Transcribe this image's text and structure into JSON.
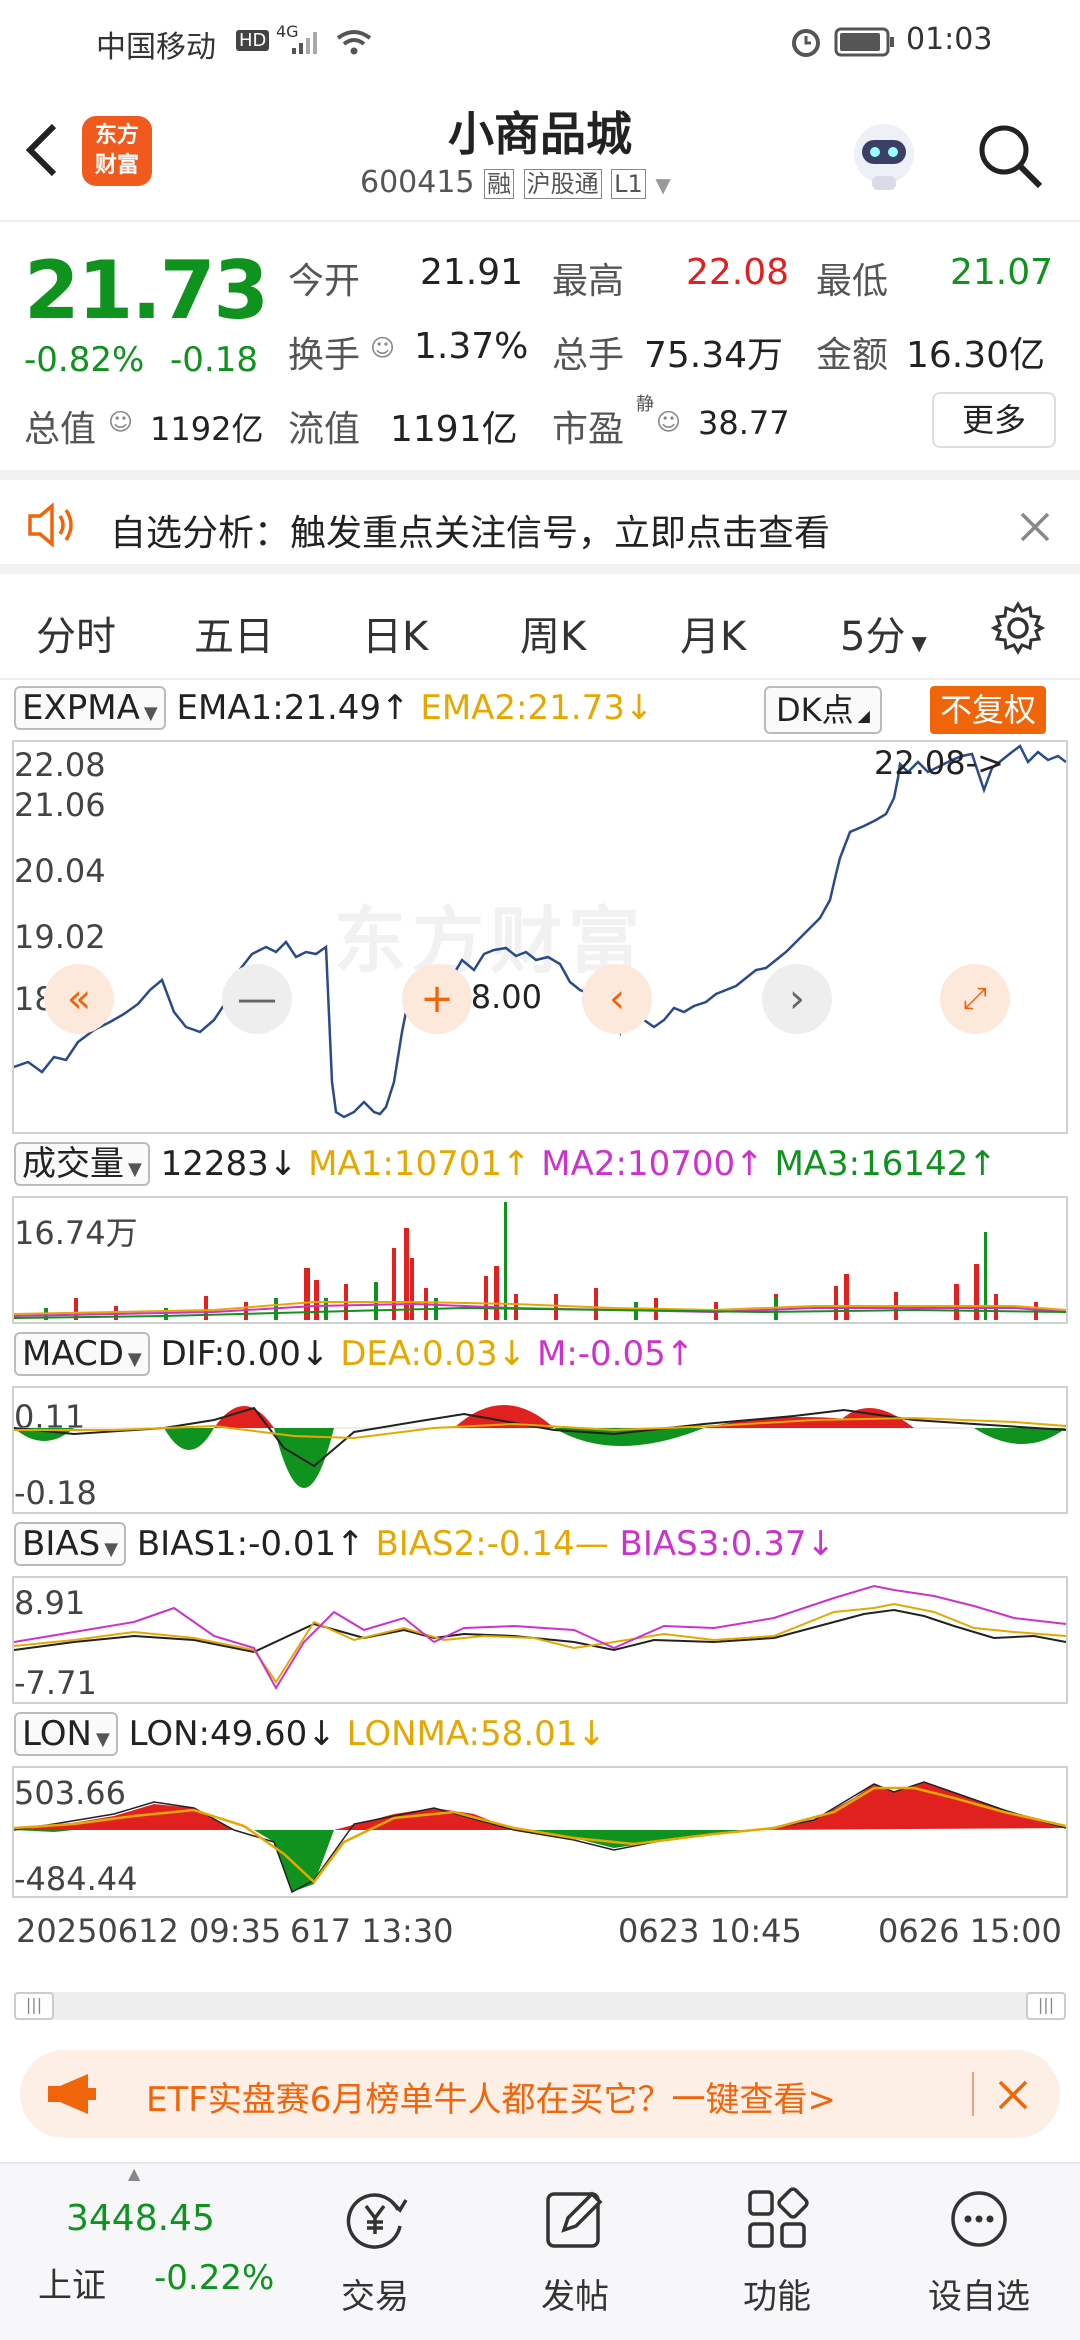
{
  "status_bar": {
    "carrier": "中国移动",
    "hd": "HD",
    "signal": "4G",
    "time": "01:03"
  },
  "header": {
    "logo_line1": "东方",
    "logo_line2": "财富",
    "title": "小商品城",
    "code": "600415",
    "tag1": "融",
    "tag2": "沪股通",
    "tag3": "L1"
  },
  "quote": {
    "price": "21.73",
    "change_pct": "-0.82%",
    "change": "-0.18",
    "open_label": "今开",
    "open": "21.91",
    "high_label": "最高",
    "high": "22.08",
    "low_label": "最低",
    "low": "21.07",
    "turnover_label": "换手",
    "turnover": "1.37%",
    "volume_label": "总手",
    "volume": "75.34万",
    "amount_label": "金额",
    "amount": "16.30亿",
    "mktcap_label": "总值",
    "mktcap": "1192亿",
    "float_label": "流值",
    "float": "1191亿",
    "pe_label": "市盈",
    "pe_sup": "静",
    "pe": "38.77",
    "more": "更多"
  },
  "notice": {
    "text": "自选分析：触发重点关注信号，立即点击查看"
  },
  "tabs": [
    "分时",
    "五日",
    "日K",
    "周K",
    "月K",
    "5分"
  ],
  "main_chart": {
    "indicator": "EXPMA",
    "ema1": "EMA1:21.49",
    "ema1_arrow": "↑",
    "ema2": "EMA2:21.73",
    "ema2_arrow": "↓",
    "dk": "DK点",
    "fq": "不复权",
    "y_labels": [
      "22.08",
      "21.06",
      "20.04",
      "19.02",
      "18.00"
    ],
    "max_mark": "22.08->",
    "min_mark": "<-18.00",
    "watermark": "东方财富"
  },
  "volume": {
    "indicator": "成交量",
    "value": "12283",
    "value_arrow": "↓",
    "ma1": "MA1:10701",
    "ma1_arrow": "↑",
    "ma2": "MA2:10700",
    "ma2_arrow": "↑",
    "ma3": "MA3:16142",
    "ma3_arrow": "↑",
    "max_label": "16.74万"
  },
  "macd": {
    "indicator": "MACD",
    "dif": "DIF:0.00",
    "dif_arrow": "↓",
    "dea": "DEA:0.03",
    "dea_arrow": "↓",
    "m": "M:-0.05",
    "m_arrow": "↑",
    "top": "0.11",
    "bottom": "-0.18"
  },
  "bias": {
    "indicator": "BIAS",
    "b1": "BIAS1:-0.01",
    "b1_arrow": "↑",
    "b2": "BIAS2:-0.14",
    "b2_arrow": "—",
    "b3": "BIAS3:0.37",
    "b3_arrow": "↓",
    "top": "8.91",
    "bottom": "-7.71"
  },
  "lon": {
    "indicator": "LON",
    "lon": "LON:49.60",
    "lon_arrow": "↓",
    "lonma": "LONMA:58.01",
    "lonma_arrow": "↓",
    "top": "503.66",
    "bottom": "-484.44"
  },
  "x_axis": [
    "20250612 09:35",
    "617 13:30",
    "0623 10:45",
    "0626 15:00"
  ],
  "ad": {
    "text": "ETF实盘赛6月榜单牛人都在买它？一键查看>"
  },
  "bottom_nav": {
    "index_value": "3448.45",
    "index_name": "上证",
    "index_change": "-0.22%",
    "trade": "交易",
    "post": "发帖",
    "func": "功能",
    "watch": "设自选"
  },
  "colors": {
    "up": "#e0211f",
    "down": "#10921f",
    "accent": "#f0640a",
    "line": "#2a4a8a",
    "gold": "#e6a800",
    "magenta": "#cc33cc"
  }
}
